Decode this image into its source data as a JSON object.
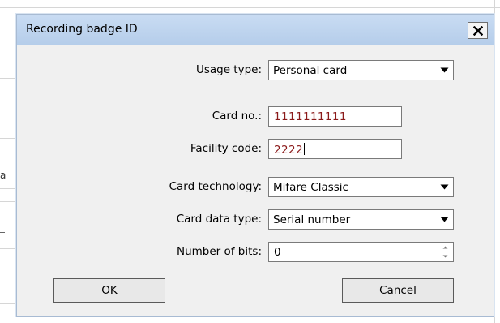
{
  "background": {
    "fragments": [
      "a"
    ]
  },
  "dialog": {
    "title": "Recording badge ID",
    "fields": {
      "usage_type": {
        "label": "Usage type:",
        "value": "Personal card"
      },
      "card_no": {
        "label": "Card no.:",
        "value": "1111111111"
      },
      "facility_code": {
        "label": "Facility code:",
        "value": "2222"
      },
      "card_technology": {
        "label": "Card technology:",
        "value": "Mifare Classic"
      },
      "card_data_type": {
        "label": "Card data type:",
        "value": "Serial number"
      },
      "number_of_bits": {
        "label": "Number of bits:",
        "value": "0"
      }
    },
    "buttons": {
      "ok": {
        "pre": "",
        "accel": "O",
        "post": "K"
      },
      "cancel": {
        "pre": "C",
        "accel": "a",
        "post": "ncel"
      }
    }
  },
  "icons": {
    "close": "close-x-icon",
    "dropdown": "chevron-down-icon",
    "spinner": "spinner-arrows-icon"
  },
  "colors": {
    "titlebar": "#c2d7f0",
    "dialog_bg": "#f0f0f0",
    "input_text": "#8b1a1a"
  }
}
